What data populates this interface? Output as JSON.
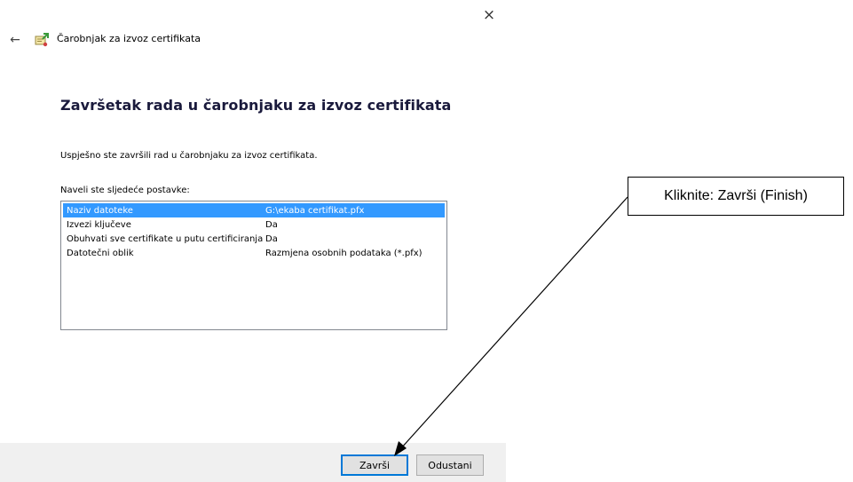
{
  "window": {
    "close_glyph": "×",
    "back_glyph": "←",
    "title": "Čarobnjak za izvoz certifikata"
  },
  "content": {
    "heading": "Završetak rada u čarobnjaku za izvoz certifikata",
    "success_text": "Uspješno ste završili rad u čarobnjaku za izvoz certifikata.",
    "settings_label": "Naveli ste sljedeće postavke:",
    "settings": [
      {
        "key": "Naziv datoteke",
        "value": "G:\\ekaba certifikat.pfx",
        "selected": true
      },
      {
        "key": "Izvezi ključeve",
        "value": "Da",
        "selected": false
      },
      {
        "key": "Obuhvati sve certifikate u putu certificiranja",
        "value": "Da",
        "selected": false
      },
      {
        "key": "Datotečni oblik",
        "value": "Razmjena osobnih podataka (*.pfx)",
        "selected": false
      }
    ]
  },
  "footer": {
    "finish_label": "Završi",
    "cancel_label": "Odustani"
  },
  "annotation": {
    "callout_text": "Kliknite: Završi (Finish)"
  },
  "colors": {
    "selection": "#3399ff",
    "focus_border": "#0078d7",
    "footer_bg": "#f0f0f0"
  }
}
